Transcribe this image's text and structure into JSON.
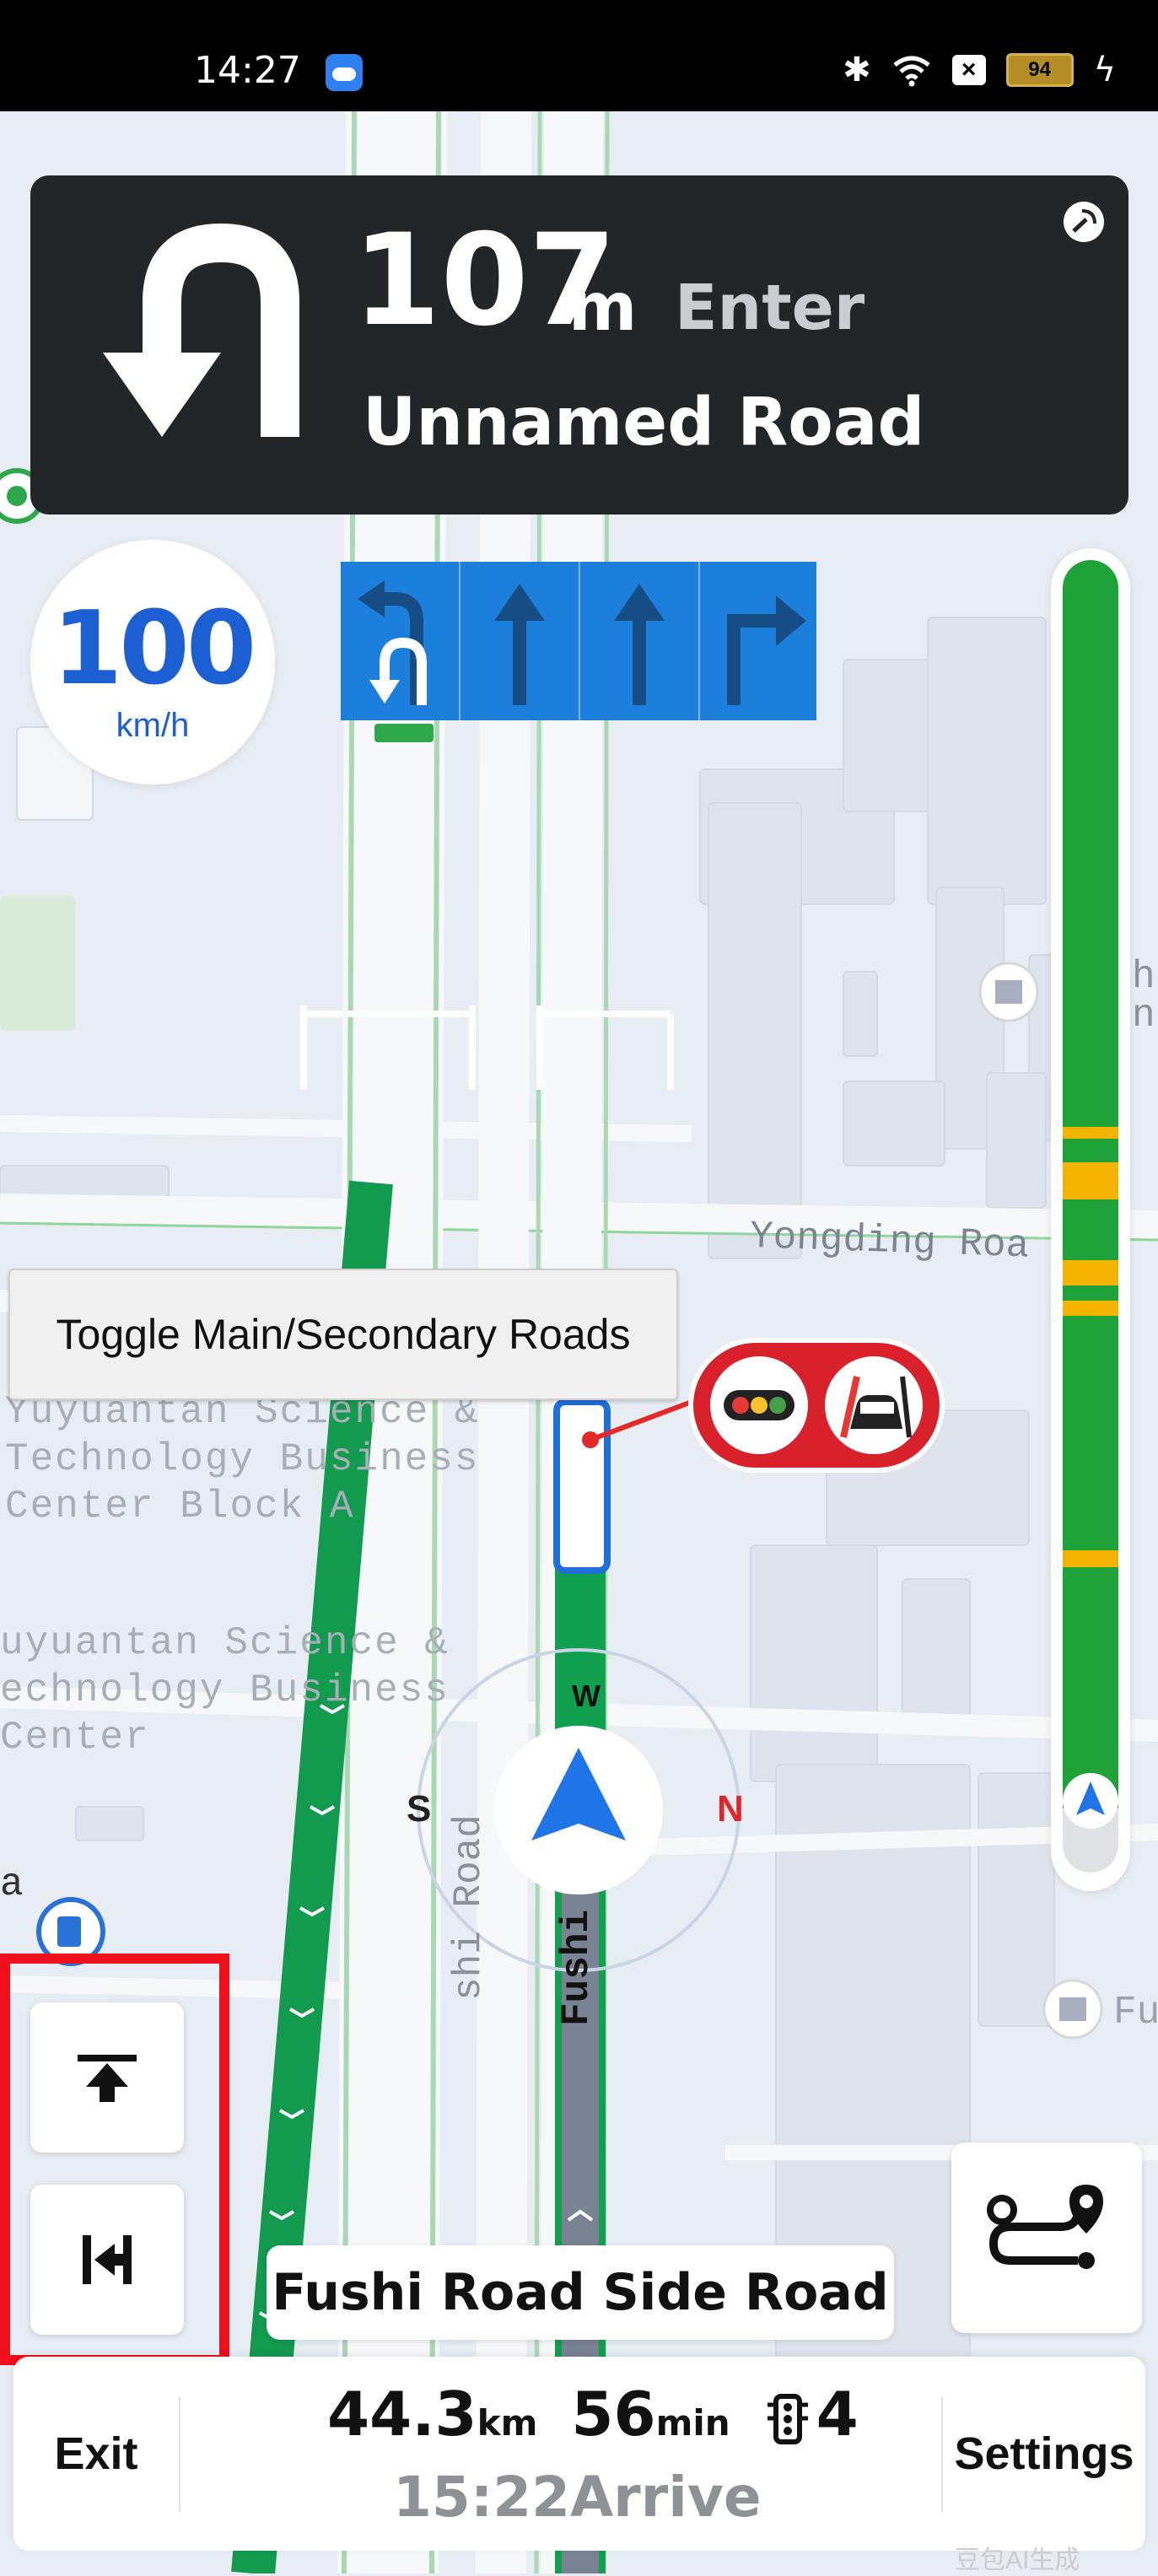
{
  "status_bar": {
    "time": "14:27",
    "battery": "94",
    "icons": [
      "weather-icon",
      "bluetooth-icon",
      "wifi-icon",
      "sim-x-icon",
      "battery-icon",
      "charging-icon"
    ]
  },
  "guidance": {
    "distance": "107",
    "distance_unit": "m",
    "action": "Enter",
    "road": "Unnamed Road",
    "maneuver": "u-turn-left"
  },
  "speed_limit": {
    "value": "100",
    "unit": "km/h"
  },
  "lanes": [
    "u-turn-left",
    "straight",
    "straight",
    "turn-right"
  ],
  "toggle_button": {
    "label": "Toggle Main/Secondary Roads"
  },
  "map_labels": {
    "road_yongding": "Yongding Roa",
    "poi_a_lines": [
      "Yuyuantan Science &",
      "Technology Business",
      "Center Block A"
    ],
    "poi_b_lines": [
      "uyuantan Science &",
      "echnology Business",
      "Center"
    ],
    "side_road_vertical": "Fushi",
    "fushi_road": "shi Road",
    "letter_a": "a",
    "right_h": "h",
    "right_n": "n",
    "right_fu": "Fu",
    "compass_s": "S",
    "compass_n": "N",
    "compass_w": "W"
  },
  "current_road": "Fushi Road Side Road",
  "trip": {
    "distance": "44.3",
    "distance_unit": "km",
    "time": "56",
    "time_unit": "min",
    "lights": "4",
    "arrival": "15:22Arrive"
  },
  "buttons": {
    "exit": "Exit",
    "settings": "Settings"
  },
  "traffic_bar": {
    "colors": {
      "clear": "#1fa338",
      "slow": "#f4b400"
    }
  },
  "watermark": "豆包AI生成"
}
